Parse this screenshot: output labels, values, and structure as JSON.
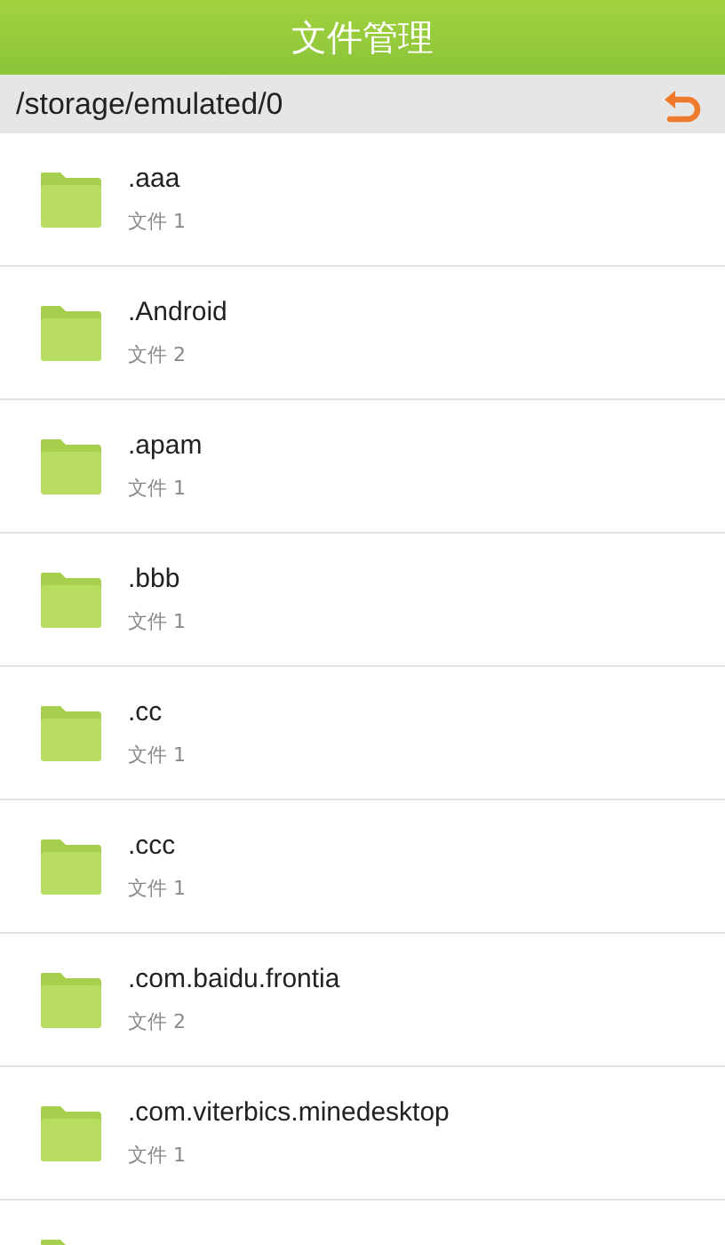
{
  "title_bar": {
    "title": "文件管理"
  },
  "path_bar": {
    "path": "/storage/emulated/0"
  },
  "items": [
    {
      "name": ".aaa",
      "detail": "文件 1"
    },
    {
      "name": ".Android",
      "detail": "文件 2"
    },
    {
      "name": ".apam",
      "detail": "文件 1"
    },
    {
      "name": ".bbb",
      "detail": "文件 1"
    },
    {
      "name": ".cc",
      "detail": "文件 1"
    },
    {
      "name": ".ccc",
      "detail": "文件 1"
    },
    {
      "name": ".com.baidu.frontia",
      "detail": "文件 2"
    },
    {
      "name": ".com.viterbics.minedesktop",
      "detail": "文件 1"
    }
  ]
}
